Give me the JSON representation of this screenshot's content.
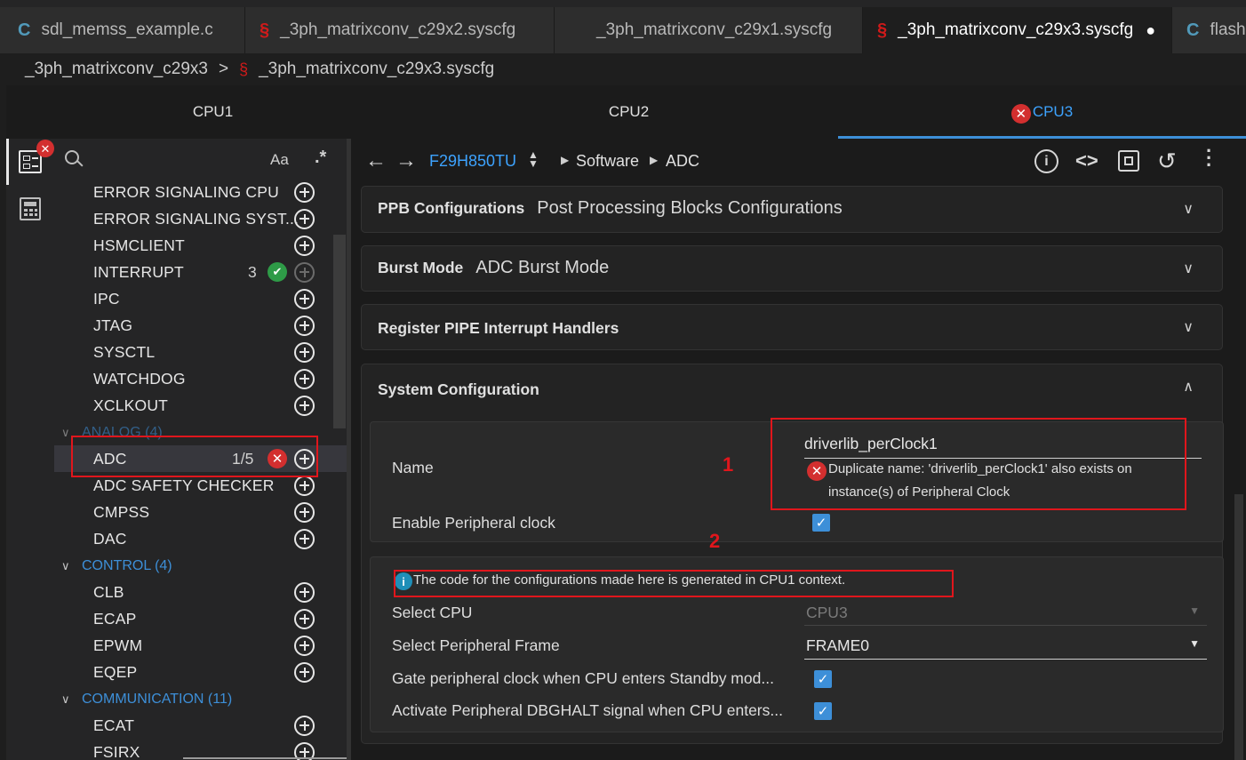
{
  "tabs": [
    {
      "label": "sdl_memss_example.c",
      "icon": "c-file-icon"
    },
    {
      "label": "_3ph_matrixconv_c29x2.syscfg",
      "icon": "syscfg-file-icon"
    },
    {
      "label": "_3ph_matrixconv_c29x1.syscfg",
      "icon": ""
    },
    {
      "label": "_3ph_matrixconv_c29x3.syscfg",
      "icon": "syscfg-file-icon",
      "dirty_mark": "●"
    },
    {
      "label": "flash",
      "icon": "c-file-icon"
    }
  ],
  "breadcrumb": {
    "folder": "_3ph_matrixconv_c29x3",
    "separator": ">",
    "file": "_3ph_matrixconv_c29x3.syscfg"
  },
  "cpu_tabs": [
    "CPU1",
    "CPU2",
    "CPU3"
  ],
  "sidebar": {
    "search_case_label": "Aa",
    "search_regex_label": ".*",
    "items": [
      {
        "label": "ERROR SIGNALING CPU"
      },
      {
        "label": "ERROR SIGNALING SYST..."
      },
      {
        "label": "HSMCLIENT"
      },
      {
        "label": "INTERRUPT",
        "count": "3"
      },
      {
        "label": "IPC"
      },
      {
        "label": "JTAG"
      },
      {
        "label": "SYSCTL"
      },
      {
        "label": "WATCHDOG"
      },
      {
        "label": "XCLKOUT"
      }
    ],
    "analog": {
      "label": "ANALOG (4)",
      "items": [
        {
          "label": "ADC",
          "count": "1/5"
        },
        {
          "label": "ADC SAFETY CHECKER"
        },
        {
          "label": "CMPSS"
        },
        {
          "label": "DAC"
        }
      ]
    },
    "control": {
      "label": "CONTROL (4)",
      "items": [
        {
          "label": "CLB"
        },
        {
          "label": "ECAP"
        },
        {
          "label": "EPWM"
        },
        {
          "label": "EQEP"
        }
      ]
    },
    "communication": {
      "label": "COMMUNICATION (11)",
      "items": [
        {
          "label": "ECAT"
        },
        {
          "label": "FSIRX"
        }
      ]
    }
  },
  "toolbar": {
    "device": "F29H850TU",
    "path1": "Software",
    "path2": "ADC"
  },
  "panels": {
    "ppb": {
      "title": "PPB Configurations",
      "subtitle": "Post Processing Blocks Configurations"
    },
    "burst": {
      "title": "Burst Mode",
      "subtitle": "ADC Burst Mode"
    },
    "pipe": {
      "title": "Register PIPE Interrupt Handlers"
    },
    "system": {
      "title": "System Configuration"
    }
  },
  "system_config": {
    "name_label": "Name",
    "name_value": "driverlib_perClock1",
    "name_error_line1": "Duplicate name: 'driverlib_perClock1' also exists on",
    "name_error_line2": "instance(s) of Peripheral Clock",
    "enable_clock_label": "Enable Peripheral clock",
    "info_text": "The code for the configurations made here is generated in CPU1 context.",
    "select_cpu_label": "Select CPU",
    "select_cpu_value": "CPU3",
    "select_frame_label": "Select Peripheral Frame",
    "select_frame_value": "FRAME0",
    "gate_label": "Gate peripheral clock when CPU enters Standby mod...",
    "dbghalt_label": "Activate Peripheral DBGHALT signal when CPU enters..."
  },
  "annotations": {
    "one": "1",
    "two": "2"
  },
  "colors": {
    "accent": "#3d8fd8",
    "error": "#d32f2f",
    "annotation_red": "#e0161c",
    "ok": "#2e9b47"
  }
}
